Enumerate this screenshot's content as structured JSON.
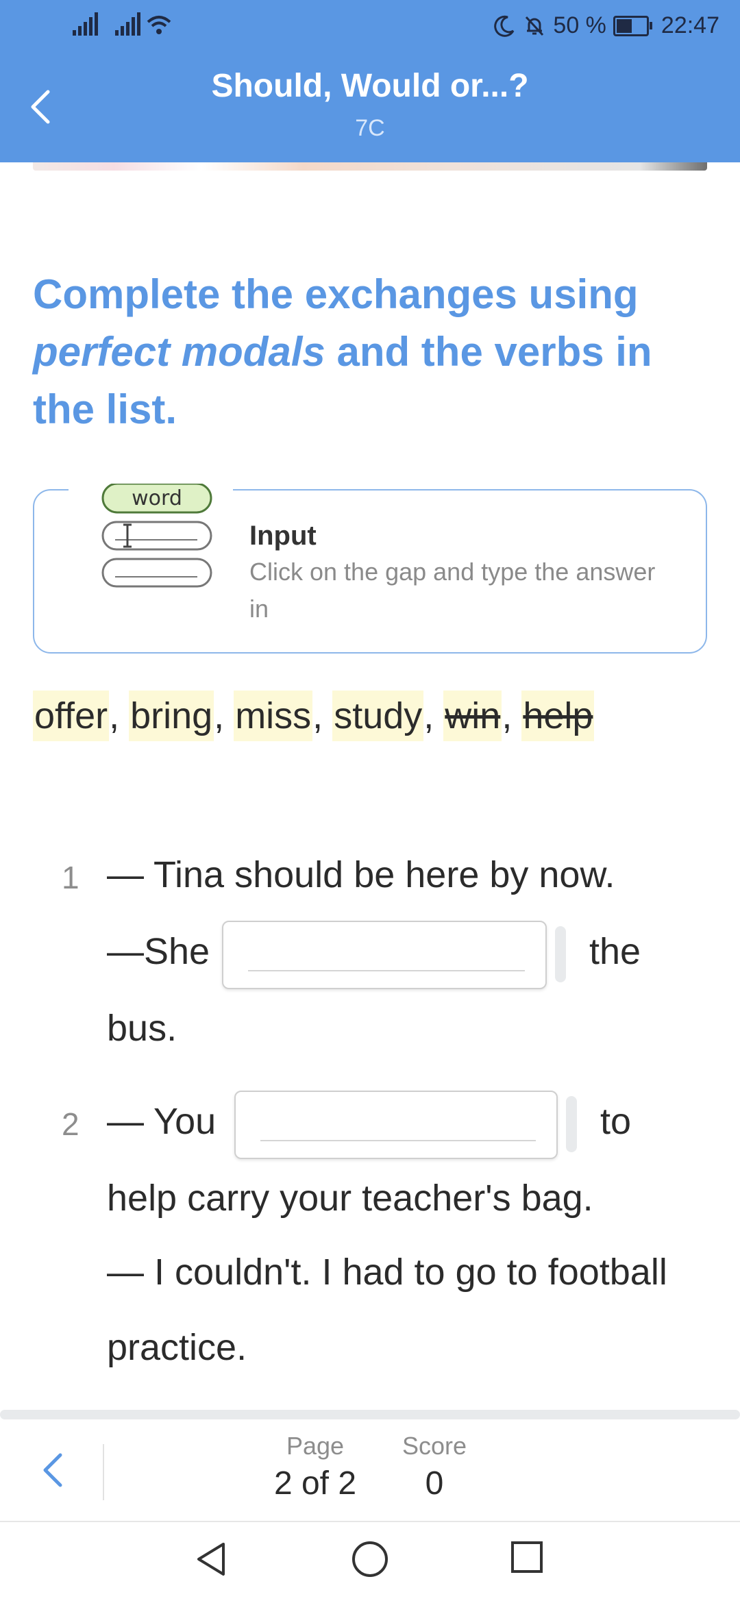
{
  "status": {
    "battery": "50 %",
    "time": "22:47"
  },
  "header": {
    "title": "Should, Would or...?",
    "subtitle": "7C"
  },
  "instruction": {
    "part1": "Complete the exchanges using ",
    "italic": "perfect modals",
    "part2": " and the verbs in the list."
  },
  "hint": {
    "illustration_word": "word",
    "title": "Input",
    "text": "Click on the gap and type the answer in"
  },
  "wordlist": {
    "words": [
      {
        "text": "offer",
        "used": false
      },
      {
        "text": "bring",
        "used": false
      },
      {
        "text": "miss",
        "used": false
      },
      {
        "text": "study",
        "used": false
      },
      {
        "text": "win",
        "used": true
      },
      {
        "text": "help",
        "used": true
      }
    ]
  },
  "exercises": [
    {
      "number": "1",
      "line1": "— Tina should be here by now.",
      "before_gap": "—She",
      "gap_value": "",
      "after_gap": "the",
      "line3": "bus."
    },
    {
      "number": "2",
      "before_gap": "— You",
      "gap_value": "",
      "after_gap": "to",
      "line2": "help carry your teacher's bag.",
      "line3": "— I couldn't. I had to go to football",
      "line4": "practice."
    }
  ],
  "footer": {
    "page_label": "Page",
    "page_value": "2 of 2",
    "score_label": "Score",
    "score_value": "0"
  },
  "icons": [
    "signal-icon",
    "wifi-icon",
    "moon-icon",
    "bell-off-icon",
    "battery-icon",
    "back-chevron-icon",
    "nav-back-icon",
    "nav-home-icon",
    "nav-recents-icon"
  ],
  "colors": {
    "accent": "#5a97e3",
    "word_highlight": "#fdf9d7"
  }
}
